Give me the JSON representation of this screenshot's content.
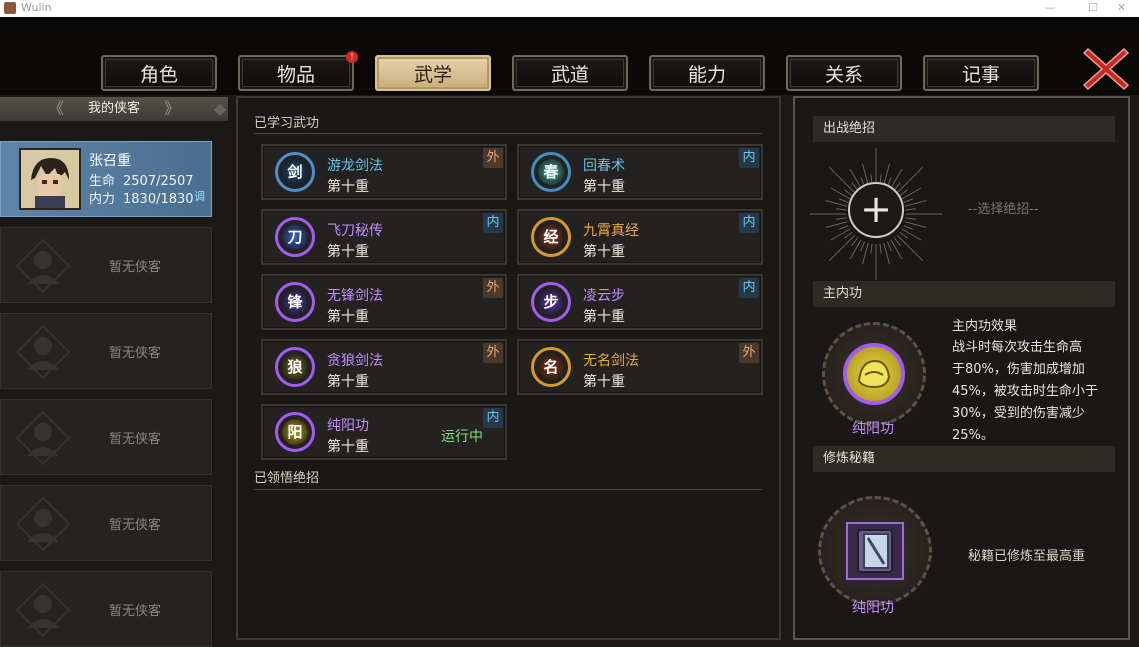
{
  "window": {
    "title": "Wulin"
  },
  "tabs": [
    {
      "label": "角色",
      "active": false,
      "badge": ""
    },
    {
      "label": "物品",
      "active": false,
      "badge": "!"
    },
    {
      "label": "武学",
      "active": true,
      "badge": ""
    },
    {
      "label": "武道",
      "active": false,
      "badge": ""
    },
    {
      "label": "能力",
      "active": false,
      "badge": ""
    },
    {
      "label": "关系",
      "active": false,
      "badge": ""
    },
    {
      "label": "记事",
      "active": false,
      "badge": ""
    }
  ],
  "party": {
    "header": "我的侠客",
    "selected": {
      "name": "张召重",
      "hp_label": "生命",
      "hp": "2507/2507",
      "mp_label": "内力",
      "mp": "1830/1830",
      "scroll_glyph": "调"
    },
    "empty_label": "暂无侠客",
    "empty_slots": 5
  },
  "skills": {
    "learned_title": "已学习武功",
    "enlightened_title": "已领悟绝招",
    "list": [
      {
        "name": "游龙剑法",
        "level": "第十重",
        "tag": "外",
        "tag_type": "wai",
        "name_color": "#5fc6ec",
        "ring": "#4a8fd0",
        "core": "#1f4f82",
        "glyph": "剑",
        "running": ""
      },
      {
        "name": "回春术",
        "level": "第十重",
        "tag": "内",
        "tag_type": "nei",
        "name_color": "#5fc6ec",
        "ring": "#3f8ec8",
        "core": "#3fae9a",
        "glyph": "春",
        "running": ""
      },
      {
        "name": "飞刀秘传",
        "level": "第十重",
        "tag": "内",
        "tag_type": "nei",
        "name_color": "#c38cff",
        "ring": "#a35cf0",
        "core": "#3b5fc4",
        "glyph": "刀",
        "running": ""
      },
      {
        "name": "九霄真经",
        "level": "第十重",
        "tag": "内",
        "tag_type": "nei",
        "name_color": "#ecaa3e",
        "ring": "#d69a2c",
        "core": "#8a3d1e",
        "glyph": "经",
        "running": ""
      },
      {
        "name": "无锋剑法",
        "level": "第十重",
        "tag": "外",
        "tag_type": "wai",
        "name_color": "#c38cff",
        "ring": "#a35cf0",
        "core": "#4a3f9c",
        "glyph": "锋",
        "running": ""
      },
      {
        "name": "凌云步",
        "level": "第十重",
        "tag": "内",
        "tag_type": "nei",
        "name_color": "#c38cff",
        "ring": "#a35cf0",
        "core": "#5a3aa0",
        "glyph": "步",
        "running": ""
      },
      {
        "name": "贪狼剑法",
        "level": "第十重",
        "tag": "外",
        "tag_type": "wai",
        "name_color": "#c38cff",
        "ring": "#a35cf0",
        "core": "#6b6a2a",
        "glyph": "狼",
        "running": ""
      },
      {
        "name": "无名剑法",
        "level": "第十重",
        "tag": "外",
        "tag_type": "wai",
        "name_color": "#ecaa3e",
        "ring": "#d69a2c",
        "core": "#8a3a18",
        "glyph": "名",
        "running": ""
      },
      {
        "name": "纯阳功",
        "level": "第十重",
        "tag": "内",
        "tag_type": "nei",
        "name_color": "#c38cff",
        "ring": "#a35cf0",
        "core": "#b8a21e",
        "glyph": "阳",
        "running": "运行中"
      }
    ]
  },
  "right": {
    "ultimate_header": "出战绝招",
    "select_hint": "--选择绝招--",
    "main_inner_header": "主内功",
    "main_inner_skill": "纯阳功",
    "effect_title": "主内功效果",
    "effect_lines": [
      "战斗时每次攻击生命高",
      "于80%，伤害加成增加",
      "45%，被攻击时生命小于",
      "30%，受到的伤害减少",
      "25%。"
    ],
    "manual_header": "修炼秘籍",
    "manual_skill": "纯阳功",
    "manual_status": "秘籍已修炼至最高重"
  },
  "colors": {
    "accent_gold": "#d8c49b",
    "purple": "#c38cff",
    "running_green": "#7fe07a",
    "close_red": "#c72a22"
  }
}
